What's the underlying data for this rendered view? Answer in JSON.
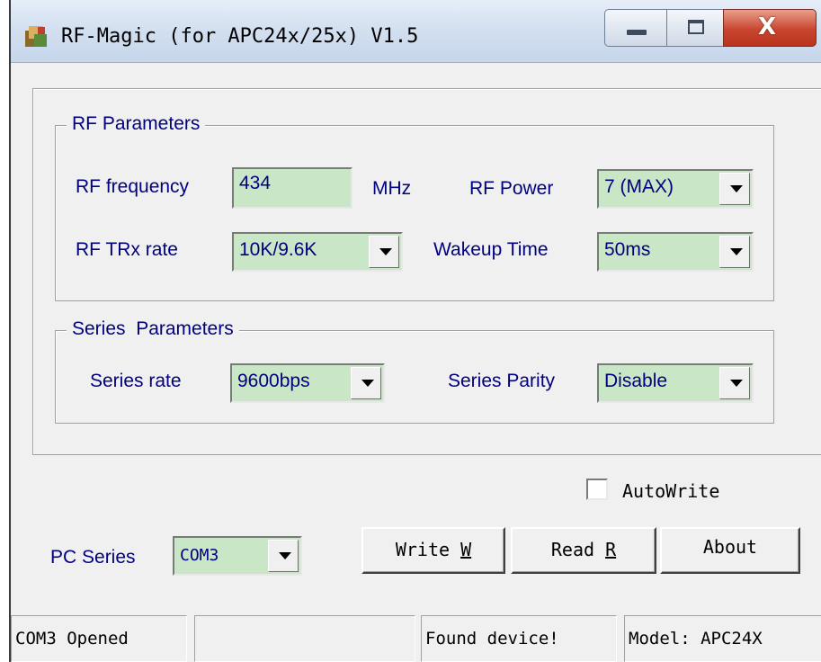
{
  "window": {
    "title": "RF-Magic (for APC24x/25x) V1.5",
    "close_glyph": "X"
  },
  "rf_group": {
    "legend": "RF Parameters",
    "frequency_label": "RF frequency",
    "frequency_value": "434",
    "frequency_unit": "MHz",
    "power_label": "RF Power",
    "power_value": "7 (MAX)",
    "trx_label": "RF TRx rate",
    "trx_value": "10K/9.6K",
    "wakeup_label": "Wakeup Time",
    "wakeup_value": "50ms"
  },
  "series_group": {
    "legend": "Series  Parameters",
    "rate_label": "Series rate",
    "rate_value": "9600bps",
    "parity_label": "Series Parity",
    "parity_value": "Disable"
  },
  "autowrite": {
    "label": "AutoWrite",
    "checked": false
  },
  "pc_series": {
    "label": "PC  Series",
    "value": "COM3"
  },
  "buttons": {
    "write": {
      "text": "Write ",
      "key": "W"
    },
    "read": {
      "text": "Read ",
      "key": "R"
    },
    "about": "About"
  },
  "status_bar": [
    "COM3 Opened",
    "",
    "Found device!",
    "Model:  APC24X"
  ],
  "colors": {
    "field_bg": "#c9e7c7",
    "label_text": "#000080",
    "close_red": "#c8452e"
  }
}
